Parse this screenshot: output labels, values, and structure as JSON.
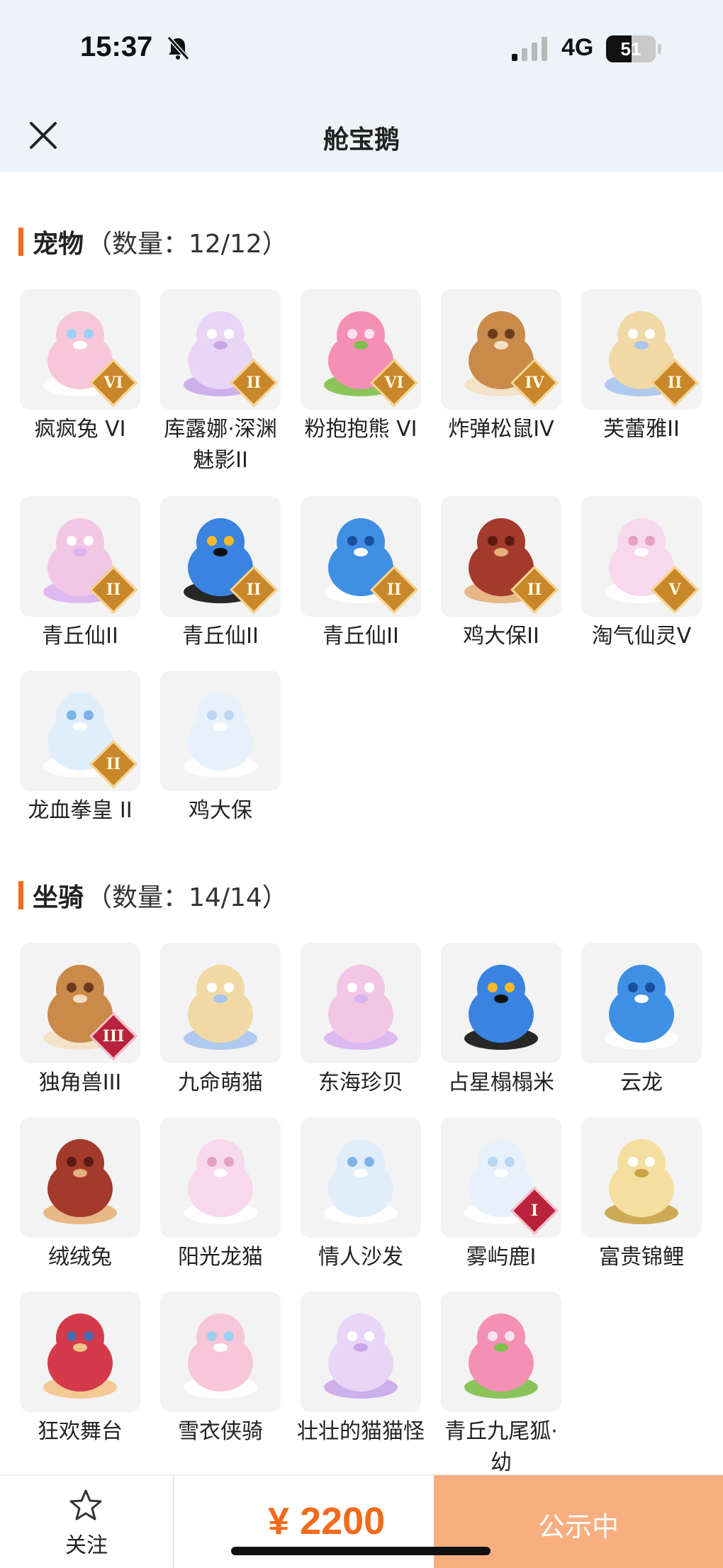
{
  "status_bar": {
    "time": "15:37",
    "network": "4G",
    "battery": "51",
    "battery_level": 0.51
  },
  "nav": {
    "title": "舱宝鹅"
  },
  "sections": {
    "pets": {
      "title": "宠物",
      "count": "（数量：12/12）",
      "items": [
        {
          "label": "疯疯兔 VI",
          "badge": "VI"
        },
        {
          "label": "库露娜·深渊魅影II",
          "badge": "II"
        },
        {
          "label": "粉抱抱熊 VI",
          "badge": "VI"
        },
        {
          "label": "炸弹松鼠IV",
          "badge": "IV"
        },
        {
          "label": "芙蕾雅II",
          "badge": "II"
        },
        {
          "label": "青丘仙II",
          "badge": "II"
        },
        {
          "label": "青丘仙II",
          "badge": "II"
        },
        {
          "label": "青丘仙II",
          "badge": "II"
        },
        {
          "label": "鸡大保II",
          "badge": "II"
        },
        {
          "label": "淘气仙灵V",
          "badge": "V"
        },
        {
          "label": "龙血拳皇 II",
          "badge": "II"
        },
        {
          "label": "鸡大保",
          "badge": ""
        }
      ]
    },
    "mounts": {
      "title": "坐骑",
      "count": "（数量：14/14）",
      "items": [
        {
          "label": "独角兽III",
          "badge": "III"
        },
        {
          "label": "九命萌猫",
          "badge": ""
        },
        {
          "label": "东海珍贝",
          "badge": ""
        },
        {
          "label": "占星榻榻米",
          "badge": ""
        },
        {
          "label": "云龙",
          "badge": ""
        },
        {
          "label": "绒绒兔",
          "badge": ""
        },
        {
          "label": "阳光龙猫",
          "badge": ""
        },
        {
          "label": "情人沙发",
          "badge": ""
        },
        {
          "label": "雾屿鹿I",
          "badge": "I"
        },
        {
          "label": "富贵锦鲤",
          "badge": ""
        },
        {
          "label": "狂欢舞台",
          "badge": ""
        },
        {
          "label": "雪衣侠骑",
          "badge": ""
        },
        {
          "label": "壮壮的猫猫怪",
          "badge": ""
        },
        {
          "label": "青丘九尾狐·幼",
          "badge": ""
        }
      ]
    }
  },
  "bottom_bar": {
    "follow_label": "关注",
    "price": "¥ 2200",
    "status": "公示中"
  },
  "colors": {
    "accent": "#f26b1d",
    "status_button": "#f9ae80",
    "header_bg": "#edf3f6"
  }
}
